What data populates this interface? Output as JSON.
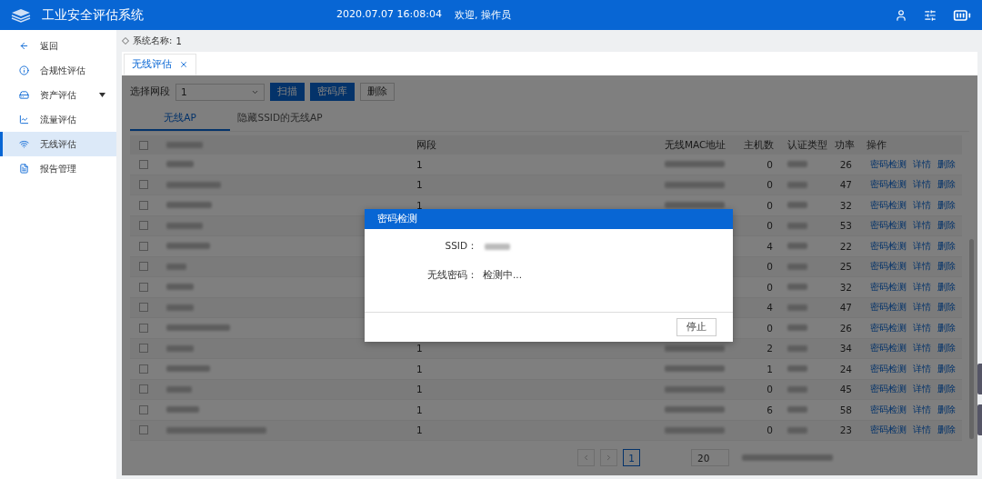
{
  "app": {
    "title": "工业安全评估系统",
    "datetime": "2020.07.07 16:08:04",
    "welcome": "欢迎, 操作员"
  },
  "sidebar": {
    "items": [
      {
        "label": "返回",
        "selected": false,
        "expandable": false
      },
      {
        "label": "合规性评估",
        "selected": false,
        "expandable": false
      },
      {
        "label": "资产评估",
        "selected": false,
        "expandable": true
      },
      {
        "label": "流量评估",
        "selected": false,
        "expandable": false
      },
      {
        "label": "无线评估",
        "selected": true,
        "expandable": false
      },
      {
        "label": "报告管理",
        "selected": false,
        "expandable": false
      }
    ]
  },
  "breadcrumb": {
    "label": "系统名称:",
    "value": "1"
  },
  "page_tabs": [
    {
      "label": "无线评估",
      "selected": true,
      "closable": true
    }
  ],
  "toolbar": {
    "label": "选择网段",
    "select_value": "1",
    "buttons": [
      {
        "label": "扫描",
        "primary": true
      },
      {
        "label": "密码库",
        "primary": true
      },
      {
        "label": "删除",
        "primary": false
      }
    ]
  },
  "sub_tabs": [
    {
      "label": "无线AP",
      "selected": true
    },
    {
      "label": "隐藏SSID的无线AP",
      "selected": false
    }
  ],
  "table": {
    "header_checked": false,
    "columns": [
      "网段",
      "无线MAC地址",
      "主机数",
      "认证类型",
      "功率",
      "操作"
    ],
    "rows": [
      {
        "checked": false,
        "segment": "1",
        "hosts": "0",
        "power": "26",
        "actions": [
          "密码检测",
          "详情",
          "删除"
        ]
      },
      {
        "checked": false,
        "segment": "1",
        "hosts": "0",
        "power": "47",
        "actions": [
          "密码检测",
          "详情",
          "删除"
        ]
      },
      {
        "checked": false,
        "segment": "1",
        "hosts": "0",
        "power": "32",
        "actions": [
          "密码检测",
          "详情",
          "删除"
        ]
      },
      {
        "checked": false,
        "hosts": "0",
        "power": "53",
        "actions": [
          "密码检测",
          "详情",
          "删除"
        ]
      },
      {
        "checked": false,
        "hosts": "4",
        "power": "22",
        "actions": [
          "密码检测",
          "详情",
          "删除"
        ]
      },
      {
        "checked": false,
        "hosts": "0",
        "power": "25",
        "actions": [
          "密码检测",
          "详情",
          "删除"
        ]
      },
      {
        "checked": false,
        "hosts": "0",
        "power": "32",
        "actions": [
          "密码检测",
          "详情",
          "删除"
        ]
      },
      {
        "checked": false,
        "hosts": "4",
        "power": "47",
        "actions": [
          "密码检测",
          "详情",
          "删除"
        ]
      },
      {
        "checked": false,
        "hosts": "0",
        "power": "26",
        "actions": [
          "密码检测",
          "详情",
          "删除"
        ]
      },
      {
        "checked": false,
        "segment": "1",
        "hosts": "2",
        "power": "34",
        "actions": [
          "密码检测",
          "详情",
          "删除"
        ]
      },
      {
        "checked": false,
        "segment": "1",
        "hosts": "1",
        "power": "24",
        "actions": [
          "密码检测",
          "详情",
          "删除"
        ]
      },
      {
        "checked": false,
        "segment": "1",
        "hosts": "0",
        "power": "45",
        "actions": [
          "密码检测",
          "详情",
          "删除"
        ]
      },
      {
        "checked": false,
        "segment": "1",
        "hosts": "6",
        "power": "58",
        "actions": [
          "密码检测",
          "详情",
          "删除"
        ]
      },
      {
        "checked": false,
        "segment": "1",
        "hosts": "0",
        "power": "23",
        "actions": [
          "密码检测",
          "详情",
          "删除"
        ]
      }
    ]
  },
  "pagination": {
    "pages": [
      {
        "label": "1",
        "selected": true
      }
    ],
    "page_size": "20"
  },
  "dialog": {
    "title": "密码检测",
    "fields": [
      {
        "label": "SSID：",
        "kind": "blurred"
      },
      {
        "label": "无线密码：",
        "kind": "text",
        "value": "检测中..."
      }
    ],
    "button": "停止"
  }
}
